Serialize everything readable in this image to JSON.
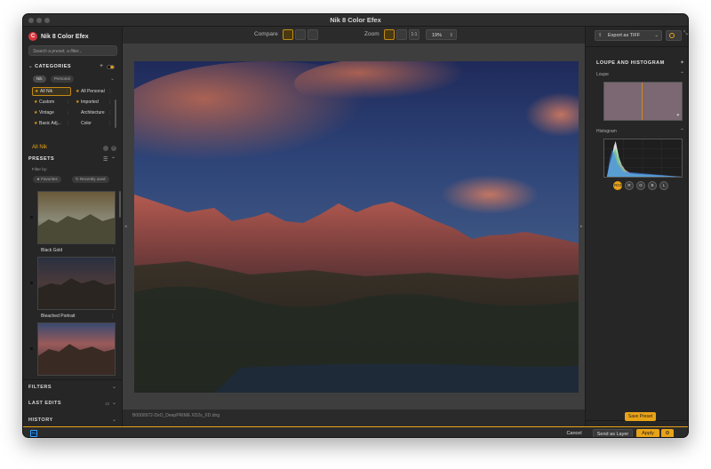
{
  "window": {
    "title": "Nik 8 Color Efex"
  },
  "brand": {
    "name": "Nik 8 Color Efex",
    "logo_letter": "C"
  },
  "search": {
    "placeholder": "Search a preset, a filter..."
  },
  "categories": {
    "title": "CATEGORIES",
    "tabs": [
      "Nik",
      "Personal"
    ],
    "items": [
      {
        "label": "All Nik",
        "star": true,
        "selected": true
      },
      {
        "label": "All Personal",
        "star": true,
        "selected": false
      },
      {
        "label": "Custom",
        "star": true,
        "selected": false
      },
      {
        "label": "Imported",
        "star": true,
        "selected": false
      },
      {
        "label": "Vintage",
        "star": true,
        "selected": false
      },
      {
        "label": "Architecture",
        "star": false,
        "selected": false
      },
      {
        "label": "Basic Adj...",
        "star": true,
        "selected": false
      },
      {
        "label": "Color",
        "star": false,
        "selected": false
      }
    ],
    "active_label": "All Nik"
  },
  "presets": {
    "title": "PRESETS",
    "filter_label": "Filter by:",
    "filters": [
      "Favorites",
      "Recently used"
    ],
    "items": [
      {
        "label": "Black Gold"
      },
      {
        "label": "Bleached Portrait"
      },
      {
        "label": ""
      }
    ]
  },
  "sections": {
    "filters": "FILTERS",
    "last_edits": "LAST EDITS",
    "last_edits_count": "15",
    "history": "HISTORY"
  },
  "toolbar": {
    "compare_label": "Compare",
    "zoom_label": "Zoom",
    "zoom_ratio": "1:1",
    "zoom_value": "19%"
  },
  "canvas": {
    "filename": "B0000972-DxO_DeepPRIME XD2s_XD.dng"
  },
  "right_panel": {
    "export_label": "Export as TIFF",
    "title": "LOUPE AND HISTOGRAM",
    "loupe_label": "Loupe",
    "histogram_label": "Histogram",
    "channels": [
      "RGB",
      "R",
      "G",
      "B",
      "L"
    ],
    "save_preset": "Save Preset"
  },
  "bottom": {
    "app_badge": "Ps",
    "cancel": "Cancel",
    "send_as_layer": "Send as Layer",
    "apply": "Apply"
  },
  "colors": {
    "accent": "#e8a317",
    "logo": "#d9363e",
    "panel": "#262626"
  }
}
